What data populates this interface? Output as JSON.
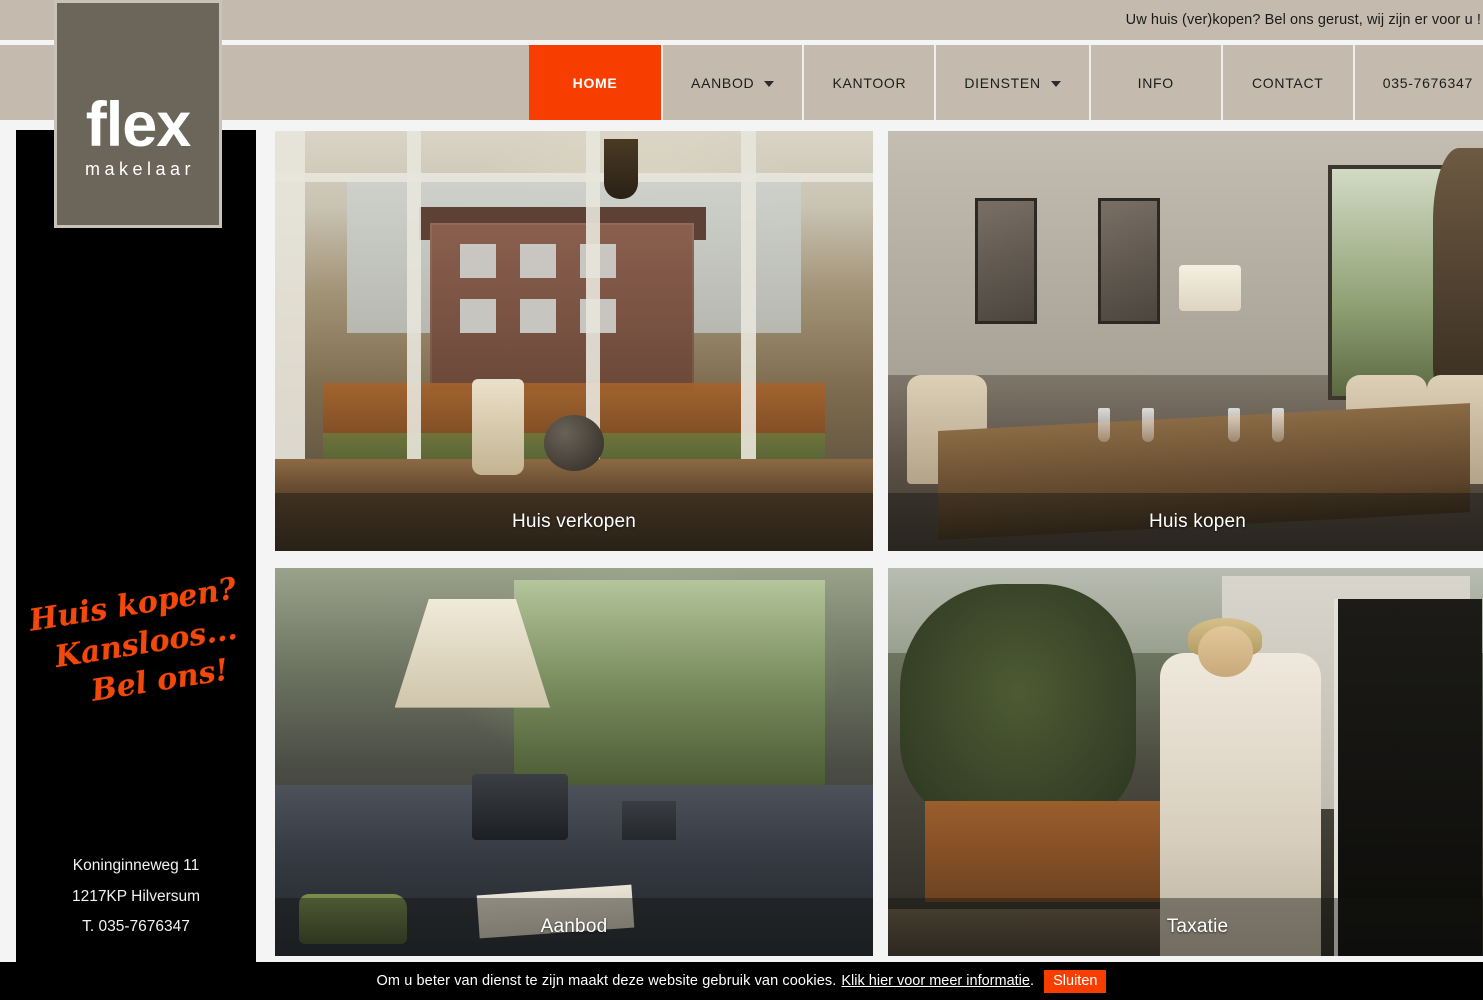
{
  "topbar": {
    "message": "Uw huis (ver)kopen? Bel ons gerust, wij zijn er voor u !"
  },
  "logo": {
    "main": "flex",
    "sub": "makelaar"
  },
  "nav": {
    "items": [
      {
        "label": "HOME",
        "active": true,
        "has_dropdown": false
      },
      {
        "label": "AANBOD",
        "active": false,
        "has_dropdown": true
      },
      {
        "label": "KANTOOR",
        "active": false,
        "has_dropdown": false
      },
      {
        "label": "DIENSTEN",
        "active": false,
        "has_dropdown": true
      },
      {
        "label": "INFO",
        "active": false,
        "has_dropdown": false
      },
      {
        "label": "CONTACT",
        "active": false,
        "has_dropdown": false
      },
      {
        "label": "035-7676347",
        "active": false,
        "has_dropdown": false
      }
    ]
  },
  "sidebar": {
    "slogan_line1": "Huis kopen?",
    "slogan_line2": "Kansloos...",
    "slogan_line3": "Bel ons!",
    "address_line1": "Koninginneweg 11",
    "address_line2": "1217KP Hilversum",
    "address_line3": "T. 035-7676347"
  },
  "tiles": [
    {
      "caption": "Huis verkopen",
      "position": "top-left"
    },
    {
      "caption": "Huis kopen",
      "position": "top-right"
    },
    {
      "caption": "Aanbod",
      "position": "bottom-left"
    },
    {
      "caption": "Taxatie",
      "position": "bottom-right"
    }
  ],
  "cookie": {
    "text": "Om u beter van dienst te zijn maakt deze website gebruik van cookies.",
    "link": "Klik hier voor meer informatie",
    "period": ".",
    "close_label": "Sluiten"
  },
  "colors": {
    "header_beige": "#c4bbae",
    "accent_orange": "#f73e00",
    "logo_gray": "#6b655a",
    "sidebar_black": "#000000",
    "slogan_orange": "#f2480c"
  }
}
